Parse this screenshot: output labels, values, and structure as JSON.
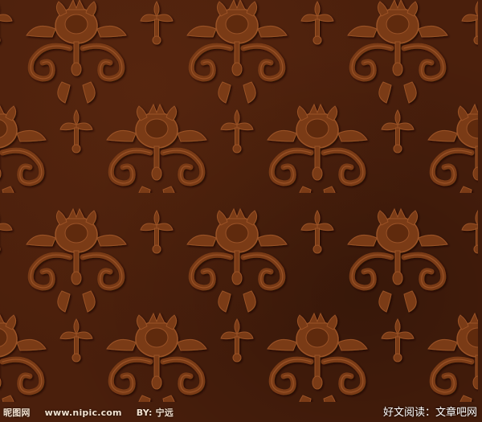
{
  "background": {
    "base_color": "#4a1f0c",
    "motif_color": "#7a3a18",
    "motif_highlight": "#9a5226",
    "motif_shadow": "#2a0f04"
  },
  "watermarks": {
    "site_name": "昵图网",
    "site_url": "www.nipic.com",
    "author_prefix": "BY:",
    "author_name": "宁远",
    "right_text": "好文阅读：文章吧网"
  }
}
